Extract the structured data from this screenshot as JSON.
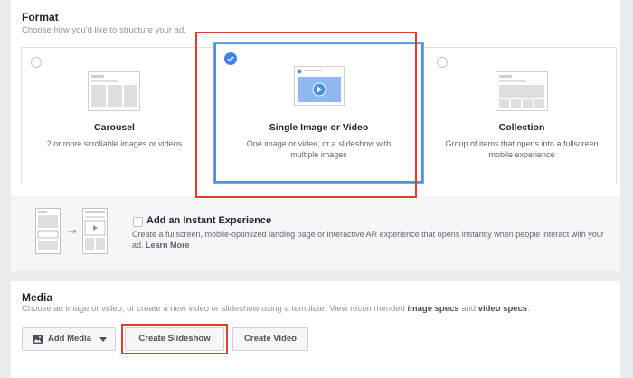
{
  "format": {
    "title": "Format",
    "description": "Choose how you'd like to structure your ad.",
    "options": [
      {
        "title": "Carousel",
        "description": "2 or more scrollable images or videos",
        "selected": false
      },
      {
        "title": "Single Image or Video",
        "description": "One image or video, or a slideshow with multiple images",
        "selected": true
      },
      {
        "title": "Collection",
        "description": "Group of items that opens into a fullscreen mobile experience",
        "selected": false
      }
    ]
  },
  "instant_experience": {
    "title": "Add an Instant Experience",
    "description": "Create a fullscreen, mobile-optimized landing page or interactive AR experience that opens instantly when people interact with your ad.",
    "learn_more": "Learn More",
    "checked": false
  },
  "media": {
    "title": "Media",
    "description_prefix": "Choose an image or video, or create a new video or slideshow using a template. View recommended",
    "image_specs": "image specs",
    "and": "and",
    "video_specs": "video specs",
    "period": ".",
    "buttons": {
      "add_media": "Add Media",
      "create_slideshow": "Create Slideshow",
      "create_video": "Create Video"
    }
  },
  "colors": {
    "selected_border": "#4a90e2",
    "check_badge": "#4080ff",
    "highlight": "#e23c2a"
  }
}
